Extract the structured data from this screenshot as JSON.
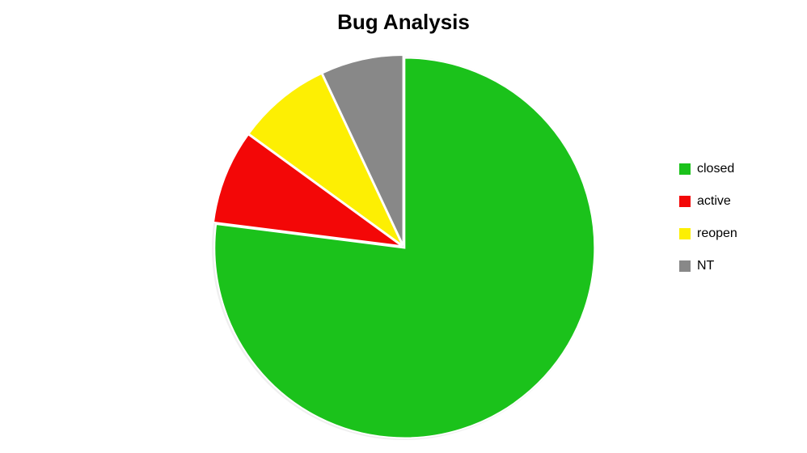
{
  "chart_data": {
    "type": "pie",
    "title": "Bug Analysis",
    "series": [
      {
        "name": "closed",
        "value": 77,
        "color": "#1bc21b"
      },
      {
        "name": "active",
        "value": 8,
        "color": "#f30707"
      },
      {
        "name": "reopen",
        "value": 8,
        "color": "#fdef03"
      },
      {
        "name": "NT",
        "value": 7,
        "color": "#888888"
      }
    ],
    "start_angle_deg": -90,
    "radius": 235,
    "explode_gap": 2
  }
}
